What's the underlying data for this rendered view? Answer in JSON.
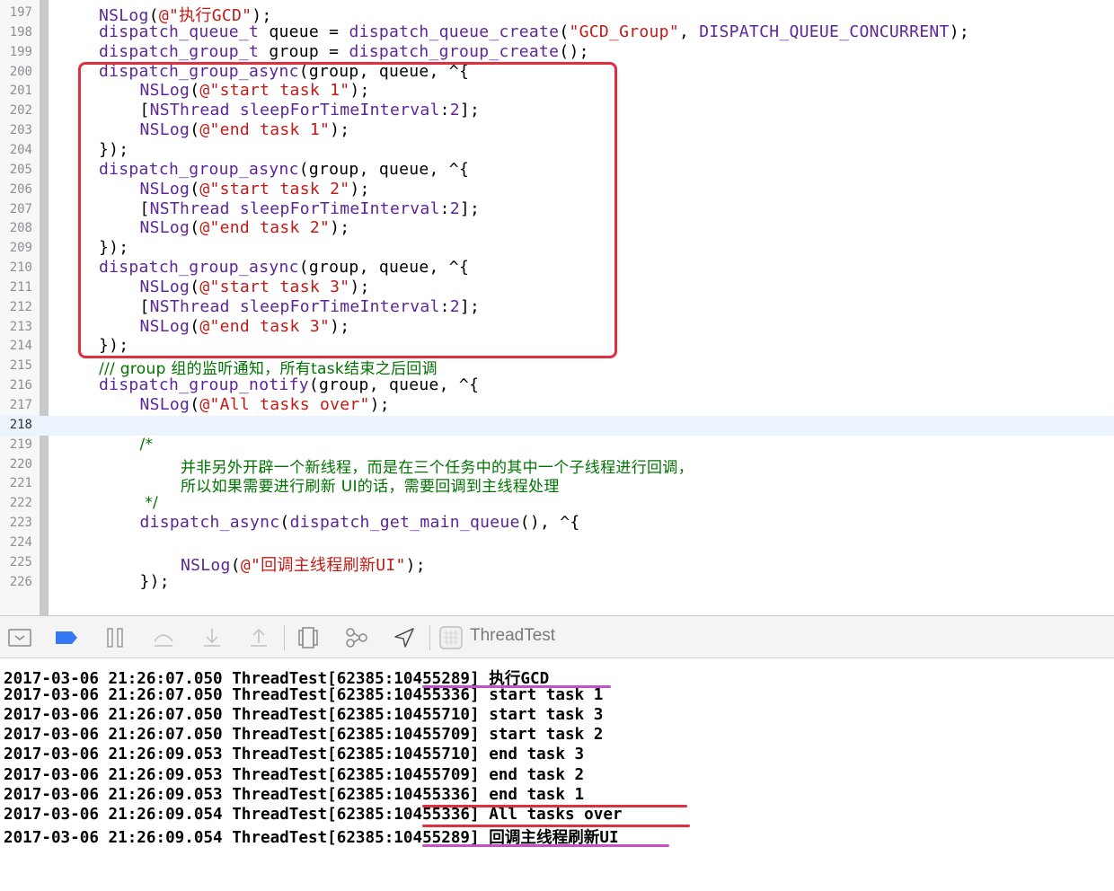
{
  "colors": {
    "keyword_purple": "#5c2699",
    "string_red": "#c41a16",
    "comment_green": "#007400",
    "plain": "#000000",
    "box_red": "#e0303f",
    "underline_purple": "#c551c8",
    "underline_red": "#e0303f",
    "accent_blue": "#3478f6"
  },
  "editor": {
    "lines": [
      {
        "num": "197",
        "indent": 0,
        "parts": [
          [
            "NSLog",
            "k"
          ],
          [
            "(",
            "p"
          ],
          [
            "@\"执行GCD\"",
            "s"
          ],
          [
            ");",
            "p"
          ]
        ]
      },
      {
        "num": "198",
        "indent": 0,
        "parts": [
          [
            "dispatch_queue_t",
            "k"
          ],
          [
            " queue = ",
            "p"
          ],
          [
            "dispatch_queue_create",
            "k"
          ],
          [
            "(",
            "p"
          ],
          [
            "\"GCD_Group\"",
            "s"
          ],
          [
            ", ",
            "p"
          ],
          [
            "DISPATCH_QUEUE_CONCURRENT",
            "k"
          ],
          [
            ");",
            "p"
          ]
        ]
      },
      {
        "num": "199",
        "indent": 0,
        "parts": [
          [
            "dispatch_group_t",
            "k"
          ],
          [
            " group = ",
            "p"
          ],
          [
            "dispatch_group_create",
            "k"
          ],
          [
            "();",
            "p"
          ]
        ]
      },
      {
        "num": "200",
        "indent": 0,
        "parts": [
          [
            "dispatch_group_async",
            "k"
          ],
          [
            "(group, queue, ^{",
            "p"
          ]
        ]
      },
      {
        "num": "201",
        "indent": 1,
        "parts": [
          [
            "NSLog",
            "k"
          ],
          [
            "(",
            "p"
          ],
          [
            "@\"start task 1\"",
            "s"
          ],
          [
            ");",
            "p"
          ]
        ]
      },
      {
        "num": "202",
        "indent": 1,
        "parts": [
          [
            "[",
            "p"
          ],
          [
            "NSThread",
            "k"
          ],
          [
            " ",
            "p"
          ],
          [
            "sleepForTimeInterval",
            "k"
          ],
          [
            ":",
            "p"
          ],
          [
            "2",
            "k"
          ],
          [
            "];",
            "p"
          ]
        ]
      },
      {
        "num": "203",
        "indent": 1,
        "parts": [
          [
            "NSLog",
            "k"
          ],
          [
            "(",
            "p"
          ],
          [
            "@\"end task 1\"",
            "s"
          ],
          [
            ");",
            "p"
          ]
        ]
      },
      {
        "num": "204",
        "indent": 0,
        "parts": [
          [
            "});",
            "p"
          ]
        ]
      },
      {
        "num": "205",
        "indent": 0,
        "parts": [
          [
            "dispatch_group_async",
            "k"
          ],
          [
            "(group, queue, ^{",
            "p"
          ]
        ]
      },
      {
        "num": "206",
        "indent": 1,
        "parts": [
          [
            "NSLog",
            "k"
          ],
          [
            "(",
            "p"
          ],
          [
            "@\"start task 2\"",
            "s"
          ],
          [
            ");",
            "p"
          ]
        ]
      },
      {
        "num": "207",
        "indent": 1,
        "parts": [
          [
            "[",
            "p"
          ],
          [
            "NSThread",
            "k"
          ],
          [
            " ",
            "p"
          ],
          [
            "sleepForTimeInterval",
            "k"
          ],
          [
            ":",
            "p"
          ],
          [
            "2",
            "k"
          ],
          [
            "];",
            "p"
          ]
        ]
      },
      {
        "num": "208",
        "indent": 1,
        "parts": [
          [
            "NSLog",
            "k"
          ],
          [
            "(",
            "p"
          ],
          [
            "@\"end task 2\"",
            "s"
          ],
          [
            ");",
            "p"
          ]
        ]
      },
      {
        "num": "209",
        "indent": 0,
        "parts": [
          [
            "});",
            "p"
          ]
        ]
      },
      {
        "num": "210",
        "indent": 0,
        "parts": [
          [
            "dispatch_group_async",
            "k"
          ],
          [
            "(group, queue, ^{",
            "p"
          ]
        ]
      },
      {
        "num": "211",
        "indent": 1,
        "parts": [
          [
            "NSLog",
            "k"
          ],
          [
            "(",
            "p"
          ],
          [
            "@\"start task 3\"",
            "s"
          ],
          [
            ");",
            "p"
          ]
        ]
      },
      {
        "num": "212",
        "indent": 1,
        "parts": [
          [
            "[",
            "p"
          ],
          [
            "NSThread",
            "k"
          ],
          [
            " ",
            "p"
          ],
          [
            "sleepForTimeInterval",
            "k"
          ],
          [
            ":",
            "p"
          ],
          [
            "2",
            "k"
          ],
          [
            "];",
            "p"
          ]
        ]
      },
      {
        "num": "213",
        "indent": 1,
        "parts": [
          [
            "NSLog",
            "k"
          ],
          [
            "(",
            "p"
          ],
          [
            "@\"end task 3\"",
            "s"
          ],
          [
            ");",
            "p"
          ]
        ]
      },
      {
        "num": "214",
        "indent": 0,
        "parts": [
          [
            "});",
            "p"
          ]
        ]
      },
      {
        "num": "215",
        "indent": 0,
        "parts": [
          [
            "/// group 组的监听通知，所有task结束之后回调",
            "c"
          ]
        ]
      },
      {
        "num": "216",
        "indent": 0,
        "parts": [
          [
            "dispatch_group_notify",
            "k"
          ],
          [
            "(group, queue, ^{",
            "p"
          ]
        ]
      },
      {
        "num": "217",
        "indent": 1,
        "parts": [
          [
            "NSLog",
            "k"
          ],
          [
            "(",
            "p"
          ],
          [
            "@\"All tasks over\"",
            "s"
          ],
          [
            ");",
            "p"
          ]
        ]
      },
      {
        "num": "218",
        "indent": 0,
        "current": true,
        "parts": []
      },
      {
        "num": "219",
        "indent": 1,
        "parts": [
          [
            "/*",
            "c"
          ]
        ]
      },
      {
        "num": "220",
        "indent": 2,
        "parts": [
          [
            "并非另外开辟一个新线程，而是在三个任务中的其中一个子线程进行回调，",
            "c"
          ]
        ]
      },
      {
        "num": "221",
        "indent": 2,
        "parts": [
          [
            "所以如果需要进行刷新 UI的话，需要回调到主线程处理",
            "c"
          ]
        ]
      },
      {
        "num": "222",
        "indent": 1,
        "parts": [
          [
            " */",
            "c"
          ]
        ]
      },
      {
        "num": "223",
        "indent": 1,
        "parts": [
          [
            "dispatch_async",
            "k"
          ],
          [
            "(",
            "p"
          ],
          [
            "dispatch_get_main_queue",
            "k"
          ],
          [
            "(), ^{",
            "p"
          ]
        ]
      },
      {
        "num": "224",
        "indent": 0,
        "parts": []
      },
      {
        "num": "225",
        "indent": 2,
        "parts": [
          [
            "NSLog",
            "k"
          ],
          [
            "(",
            "p"
          ],
          [
            "@\"回调主线程刷新UI\"",
            "s"
          ],
          [
            ");",
            "p"
          ]
        ]
      },
      {
        "num": "226",
        "indent": 1,
        "parts": [
          [
            "});",
            "p"
          ]
        ]
      }
    ]
  },
  "toolbar": {
    "scheme_label": "ThreadTest",
    "icons": [
      "hide-debug-area-icon",
      "breakpoints-active-icon",
      "pause-icon",
      "step-over-icon",
      "step-into-icon",
      "step-out-icon",
      "view-hierarchy-icon",
      "memory-graph-icon",
      "simulate-location-icon",
      "app-target-icon"
    ]
  },
  "console": {
    "lines": [
      "2017-03-06 21:26:07.050 ThreadTest[62385:10455289] 执行GCD",
      "2017-03-06 21:26:07.050 ThreadTest[62385:10455336] start task 1",
      "2017-03-06 21:26:07.050 ThreadTest[62385:10455710] start task 3",
      "2017-03-06 21:26:07.050 ThreadTest[62385:10455709] start task 2",
      "2017-03-06 21:26:09.053 ThreadTest[62385:10455710] end task 3",
      "2017-03-06 21:26:09.053 ThreadTest[62385:10455709] end task 2",
      "2017-03-06 21:26:09.053 ThreadTest[62385:10455336] end task 1",
      "2017-03-06 21:26:09.054 ThreadTest[62385:10455336] All tasks over",
      "2017-03-06 21:26:09.054 ThreadTest[62385:10455289] 回调主线程刷新UI"
    ]
  }
}
